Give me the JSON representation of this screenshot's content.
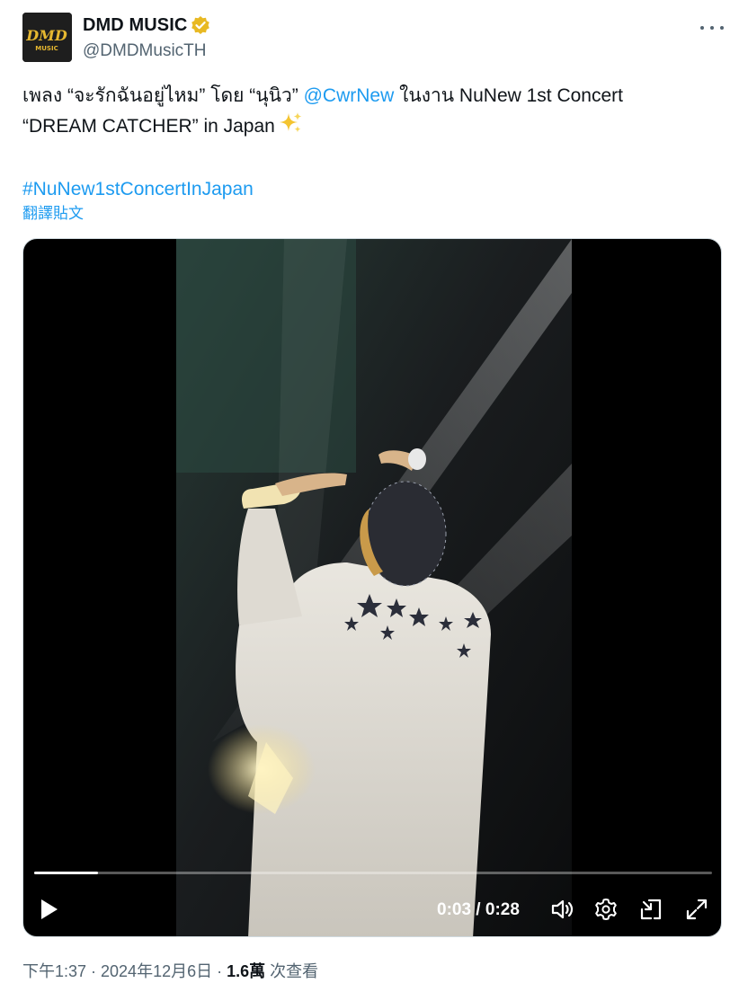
{
  "account": {
    "display_name": "DMD MUSIC",
    "handle": "@DMDMusicTH",
    "avatar_text_top": "DMD",
    "avatar_text_bottom": "MUSIC",
    "verified_icon": "verified-badge-icon",
    "verified_color": "#e8b923"
  },
  "tweet": {
    "line1_pre": "เพลง “จะรักฉันอยู่ไหม” โดย “นุนิว” ",
    "mention": "@CwrNew",
    "line1_post": " ในงาน NuNew 1st Concert",
    "line2": "“DREAM CATCHER” in Japan",
    "emoji_icon": "sparkles-icon",
    "hashtag": "#NuNew1stConcertInJapan",
    "translate_label": "翻譯貼文"
  },
  "video": {
    "current_time": "0:03",
    "separator": " / ",
    "duration": "0:28",
    "progress_fraction": 0.094,
    "icons": [
      "play-icon",
      "volume-icon",
      "settings-gear-icon",
      "picture-in-picture-icon",
      "fullscreen-icon"
    ]
  },
  "meta": {
    "time_date": "下午1:37 · 2024年12月6日 · ",
    "views_count": "1.6萬",
    "views_label": " 次查看"
  },
  "colors": {
    "link": "#1d9bf0",
    "secondary_text": "#536471",
    "primary_text": "#0f1419"
  }
}
